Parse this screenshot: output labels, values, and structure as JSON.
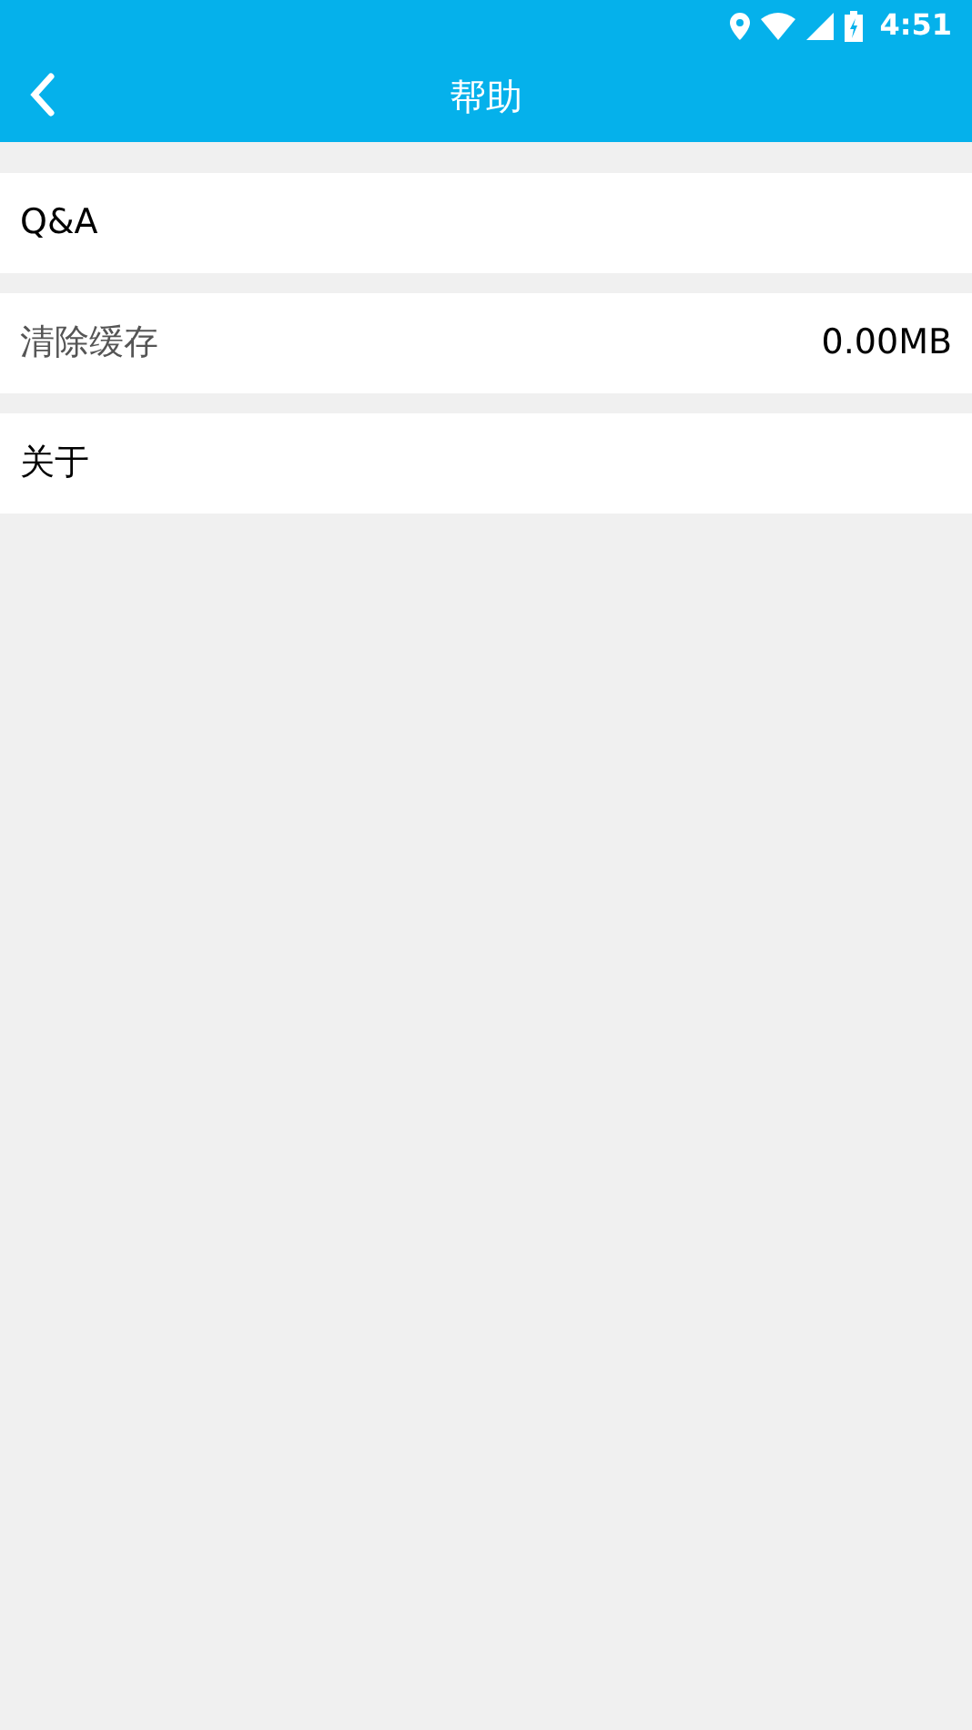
{
  "status_bar": {
    "time": "4:51"
  },
  "header": {
    "title": "帮助"
  },
  "items": [
    {
      "kind": "link",
      "label": "Q&A"
    },
    {
      "kind": "setting",
      "label": "清除缓存",
      "value": "0.00MB"
    },
    {
      "kind": "link",
      "label": "关于"
    }
  ]
}
